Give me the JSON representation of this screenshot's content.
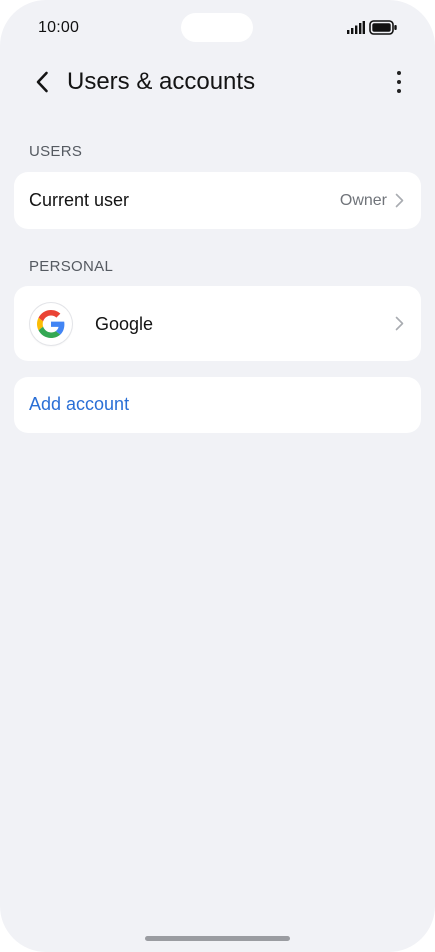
{
  "status_bar": {
    "time": "10:00",
    "icons": [
      "signal-icon",
      "battery-icon"
    ]
  },
  "header": {
    "title": "Users & accounts",
    "back_icon": "chevron-left-icon",
    "more_icon": "more-vertical-icon"
  },
  "users_section": {
    "label": "USERS",
    "current_user": {
      "label": "Current user",
      "value": "Owner"
    }
  },
  "personal_section": {
    "label": "PERSONAL",
    "accounts": [
      {
        "label": "Google",
        "icon": "google-logo-icon"
      }
    ]
  },
  "add_account": {
    "label": "Add account",
    "color": "#2a6fd6"
  },
  "colors": {
    "background": "#f1f2f6",
    "card": "#ffffff",
    "accent": "#2a6fd6"
  }
}
